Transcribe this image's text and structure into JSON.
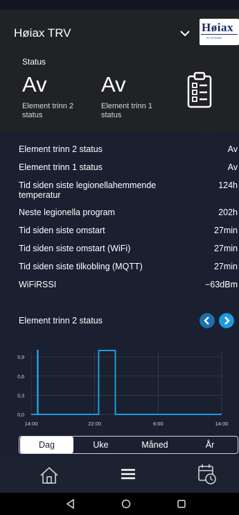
{
  "app": {
    "title": "Høiax TRV"
  },
  "logo": {
    "word": "Høiax",
    "sub": "SYSTEMS"
  },
  "status": {
    "section_label": "Status",
    "tiles": [
      {
        "value": "Av",
        "label": "Element trinn 2 status"
      },
      {
        "value": "Av",
        "label": "Element trinn 1 status"
      }
    ]
  },
  "info": [
    {
      "label": "Element trinn 2 status",
      "value": "Av"
    },
    {
      "label": "Element trinn 1 status",
      "value": "Av"
    },
    {
      "label": "Tid siden siste legionellahemmende temperatur",
      "value": "124h"
    },
    {
      "label": "Neste legionella program",
      "value": "202h"
    },
    {
      "label": "Tid siden siste omstart",
      "value": "27min"
    },
    {
      "label": "Tid siden siste omstart (WiFi)",
      "value": "27min"
    },
    {
      "label": "Tid siden siste tilkobling (MQTT)",
      "value": "27min"
    },
    {
      "label": "WiFiRSSI",
      "value": "−63dBm"
    }
  ],
  "chart_section": {
    "title": "Element trinn 2 status"
  },
  "chart_data": {
    "type": "line",
    "title": "Element trinn 2 status",
    "x_ticks": [
      "14:00",
      "22:00",
      "6:00",
      "14:00"
    ],
    "y_ticks": [
      "0,0",
      "0,3",
      "0,6",
      "0,9"
    ],
    "ylim": [
      0,
      1.0
    ],
    "x_range_hours": [
      0,
      24
    ],
    "x": [
      0,
      0.8,
      0.8,
      0.85,
      0.85,
      8.5,
      8.5,
      10.6,
      10.6,
      24
    ],
    "y": [
      0,
      0,
      1,
      1,
      0,
      0,
      1,
      1,
      0,
      0
    ],
    "color": "#1e9ae0",
    "grid": true
  },
  "tabs": {
    "items": [
      "Dag",
      "Uke",
      "Måned",
      "År"
    ],
    "active": "Dag"
  },
  "colors": {
    "accent": "#1e9ae0",
    "header": "#202226",
    "background": "#1a2030"
  },
  "bottom_nav": [
    "home-icon",
    "menu-icon",
    "calendar-clock-icon"
  ],
  "system_nav": [
    "back-icon",
    "home-circle-icon",
    "recents-icon"
  ]
}
